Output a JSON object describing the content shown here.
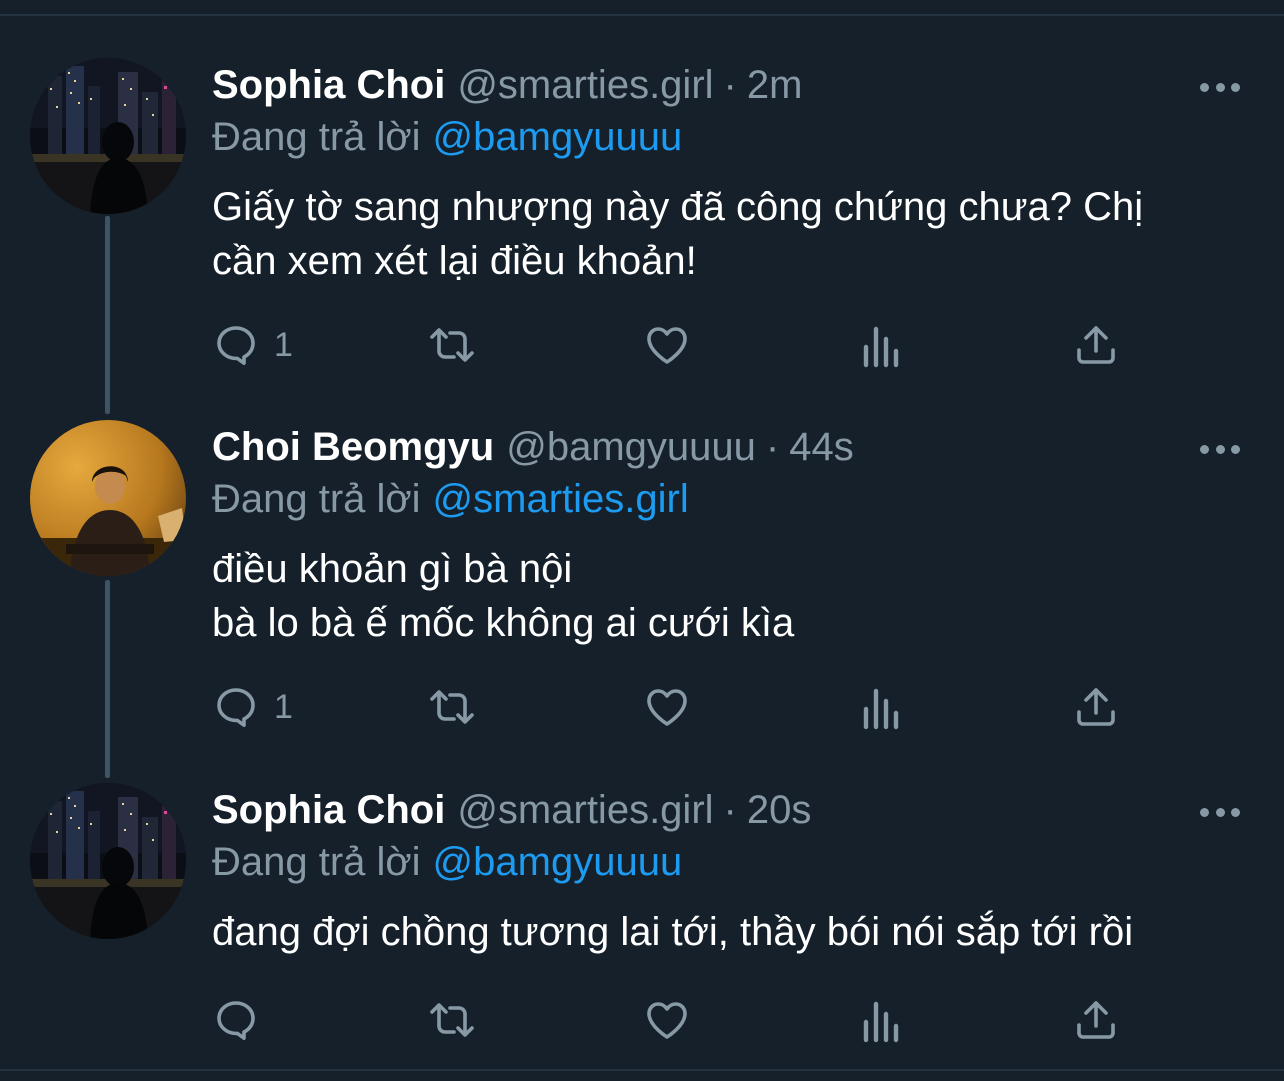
{
  "tweets": [
    {
      "name": "Sophia Choi",
      "handle": "@smarties.girl",
      "sep": "·",
      "time": "2m",
      "reply_prefix": "Đang trả lời",
      "reply_handle": "@bamgyuuuu",
      "lines": [
        "Giấy tờ sang nhượng này đã công chứng chưa? Chị",
        "cần xem xét lại điều khoản!"
      ],
      "reply_count": "1",
      "retweet_count": "",
      "like_count": "",
      "avatar": "night-city-skyline"
    },
    {
      "name": "Choi Beomgyu",
      "handle": "@bamgyuuuu",
      "sep": "·",
      "time": "44s",
      "reply_prefix": "Đang trả lời",
      "reply_handle": "@smarties.girl",
      "lines": [
        "điều khoản gì bà nội",
        "bà lo bà ế mốc không ai cưới kìa"
      ],
      "reply_count": "1",
      "retweet_count": "",
      "like_count": "",
      "avatar": "person-warm-light"
    },
    {
      "name": "Sophia Choi",
      "handle": "@smarties.girl",
      "sep": "·",
      "time": "20s",
      "reply_prefix": "Đang trả lời",
      "reply_handle": "@bamgyuuuu",
      "lines": [
        "đang đợi chồng tương lai tới, thầy bói nói sắp tới rồi"
      ],
      "reply_count": "",
      "retweet_count": "",
      "like_count": "",
      "avatar": "night-city-skyline"
    }
  ],
  "colors": {
    "background": "#15202b",
    "text_primary": "#ffffff",
    "text_secondary": "#8899a6",
    "link": "#1d9bf0",
    "thread_line": "#3d5466",
    "divider": "#253341"
  },
  "icons": {
    "reply": "reply-icon",
    "retweet": "retweet-icon",
    "like": "heart-icon",
    "analytics": "analytics-icon",
    "share": "share-icon",
    "more": "more-options-icon"
  }
}
